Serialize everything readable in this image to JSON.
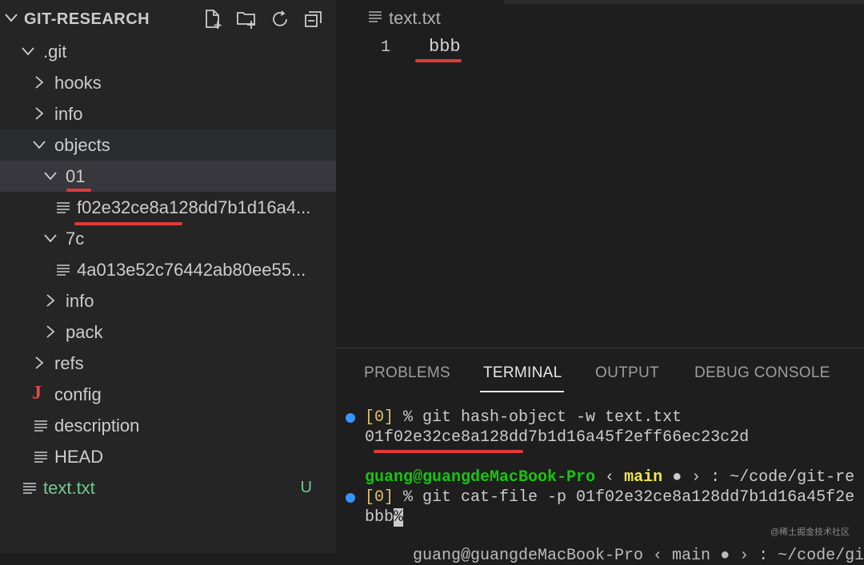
{
  "explorer": {
    "title": "GIT-RESEARCH",
    "actions": [
      "new-file-icon",
      "new-folder-icon",
      "refresh-icon",
      "collapse-all-icon"
    ],
    "tree": [
      {
        "label": ".git",
        "kind": "folder",
        "expanded": true
      },
      {
        "label": "hooks",
        "kind": "folder",
        "expanded": false
      },
      {
        "label": "info",
        "kind": "folder",
        "expanded": false
      },
      {
        "label": "objects",
        "kind": "folder",
        "expanded": true
      },
      {
        "label": "01",
        "kind": "folder",
        "expanded": true
      },
      {
        "label": "f02e32ce8a128dd7b1d16a4...",
        "kind": "file"
      },
      {
        "label": "7c",
        "kind": "folder",
        "expanded": true
      },
      {
        "label": "4a013e52c76442ab80ee55...",
        "kind": "file"
      },
      {
        "label": "info",
        "kind": "folder",
        "expanded": false
      },
      {
        "label": "pack",
        "kind": "folder",
        "expanded": false
      },
      {
        "label": "refs",
        "kind": "folder",
        "expanded": false
      },
      {
        "label": "config",
        "kind": "file-j"
      },
      {
        "label": "description",
        "kind": "file"
      },
      {
        "label": "HEAD",
        "kind": "file"
      },
      {
        "label": "text.txt",
        "kind": "file",
        "status": "U"
      }
    ]
  },
  "editor": {
    "tab_label": "text.txt",
    "lines": [
      {
        "number": "1",
        "text": "bbb"
      }
    ]
  },
  "panel": {
    "tabs": [
      "PROBLEMS",
      "TERMINAL",
      "OUTPUT",
      "DEBUG CONSOLE"
    ],
    "active_tab": "TERMINAL",
    "terminal": {
      "line1_idx": "[0]",
      "line1_cmd": " % git hash-object -w text.txt",
      "line2": "01f02e32ce8a128dd7b1d16a45f2eff66ec23c2d",
      "prompt_user": "guang@guangdeMacBook-Pro",
      "prompt_sep1": " ‹ ",
      "prompt_branch": "main",
      "prompt_dot": " ● ",
      "prompt_rest": "› : ~/code/git-re",
      "line4_idx": "[0]",
      "line4_cmd": " % git cat-file -p 01f02e32ce8a128dd7b1d16a45f2e",
      "line5_text": "bbb",
      "line5_cursor": "%",
      "line6_partial": "guang@guangdeMacBook-Pro ‹ main ● › : ~/code/git-re"
    }
  },
  "watermark": "@稀土掘金技术社区",
  "colors": {
    "accent_red": "#e03a3a",
    "untracked_green": "#73c991",
    "prompt_green": "#16c60c",
    "branch_yellow": "#f0e64a",
    "dot_blue": "#3794ff"
  }
}
